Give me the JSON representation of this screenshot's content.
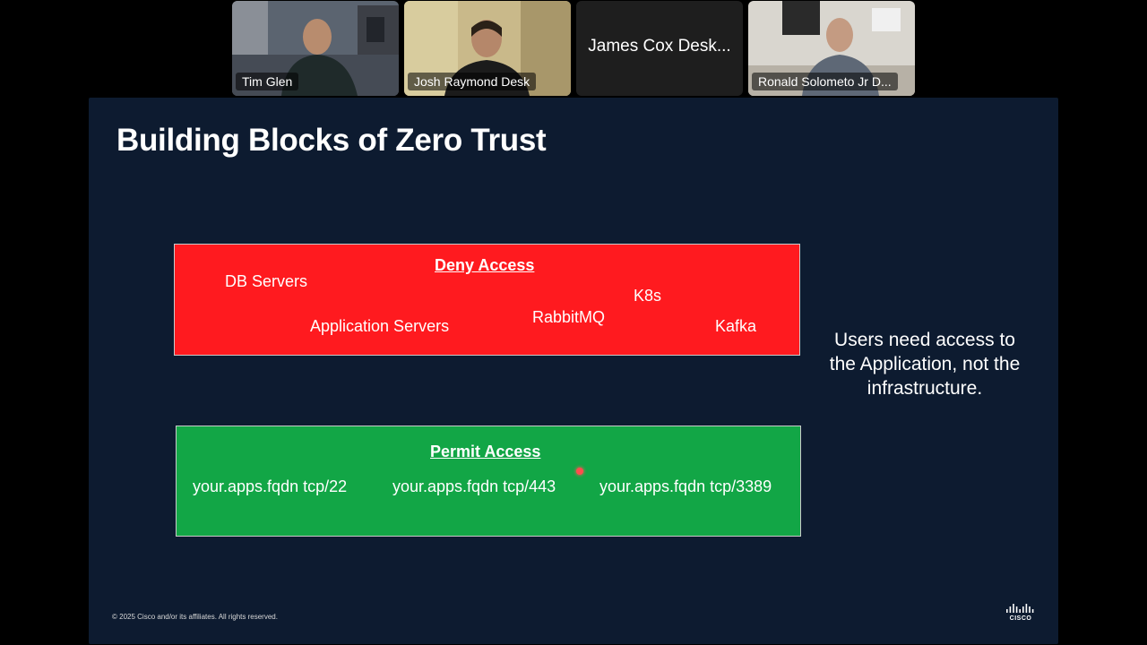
{
  "participants": [
    {
      "name": "Tim Glen",
      "video": true
    },
    {
      "name": "Josh Raymond Desk",
      "video": true
    },
    {
      "name": "James Cox Desk...",
      "video": false
    },
    {
      "name": "Ronald Solometo Jr D...",
      "video": true
    }
  ],
  "slide": {
    "title": "Building Blocks of Zero Trust",
    "deny": {
      "heading": "Deny Access",
      "items": [
        "DB Servers",
        "Application Servers",
        "RabbitMQ",
        "K8s",
        "Kafka"
      ]
    },
    "permit": {
      "heading": "Permit Access",
      "items": [
        "your.apps.fqdn tcp/22",
        "your.apps.fqdn tcp/443",
        "your.apps.fqdn tcp/3389"
      ]
    },
    "side_note": "Users need access to the Application, not the infrastructure.",
    "copyright": "© 2025 Cisco and/or its affiliates. All rights reserved.",
    "logo_text": "CISCO"
  },
  "colors": {
    "slide_bg": "#0d1b30",
    "deny_red": "#ff1a1f",
    "permit_green": "#12a646"
  }
}
